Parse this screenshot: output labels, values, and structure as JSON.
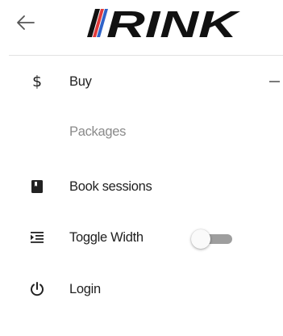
{
  "header": {
    "back_icon": "arrow-left-icon",
    "logo": {
      "text": "RINK",
      "stripe_colors": [
        "#e03a3a",
        "#2f63c8"
      ],
      "text_color": "#111111"
    }
  },
  "menu": {
    "items": [
      {
        "key": "buy",
        "label": "Buy",
        "icon": "dollar-icon",
        "expanded": true,
        "collapse_icon": "minus-icon"
      },
      {
        "key": "packages",
        "label": "Packages",
        "sub": true
      },
      {
        "key": "book-sessions",
        "label": "Book sessions",
        "icon": "book-icon"
      },
      {
        "key": "toggle-width",
        "label": "Toggle Width",
        "icon": "format-indent-icon",
        "toggle": {
          "on": false
        }
      },
      {
        "key": "login",
        "label": "Login",
        "icon": "power-icon"
      }
    ]
  },
  "colors": {
    "divider": "#e2e2e2",
    "toggle_track": "#9e9e9e",
    "toggle_thumb": "#fafafa",
    "sub_label": "#8a8a8a"
  }
}
